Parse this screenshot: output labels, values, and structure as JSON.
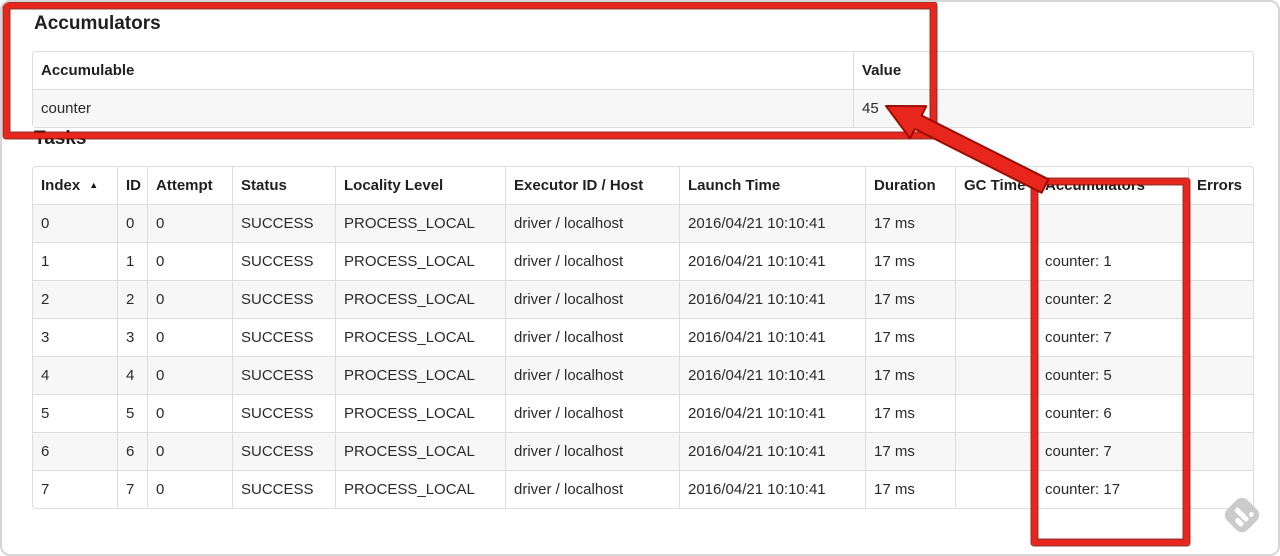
{
  "accumulators_section": {
    "title": "Accumulators",
    "table": {
      "headers": [
        "Accumulable",
        "Value"
      ],
      "rows": [
        {
          "accumulable": "counter",
          "value": "45"
        }
      ]
    }
  },
  "tasks_section": {
    "title": "Tasks",
    "table": {
      "headers": [
        "Index",
        "ID",
        "Attempt",
        "Status",
        "Locality Level",
        "Executor ID / Host",
        "Launch Time",
        "Duration",
        "GC Time",
        "Accumulators",
        "Errors"
      ],
      "sort": {
        "column": "Index",
        "direction": "asc",
        "icon": "▲"
      },
      "rows": [
        {
          "index": "0",
          "id": "0",
          "attempt": "0",
          "status": "SUCCESS",
          "locality_level": "PROCESS_LOCAL",
          "executor_id_host": "driver / localhost",
          "launch_time": "2016/04/21 10:10:41",
          "duration": "17 ms",
          "gc_time": "",
          "accumulators": "",
          "errors": ""
        },
        {
          "index": "1",
          "id": "1",
          "attempt": "0",
          "status": "SUCCESS",
          "locality_level": "PROCESS_LOCAL",
          "executor_id_host": "driver / localhost",
          "launch_time": "2016/04/21 10:10:41",
          "duration": "17 ms",
          "gc_time": "",
          "accumulators": "counter: 1",
          "errors": ""
        },
        {
          "index": "2",
          "id": "2",
          "attempt": "0",
          "status": "SUCCESS",
          "locality_level": "PROCESS_LOCAL",
          "executor_id_host": "driver / localhost",
          "launch_time": "2016/04/21 10:10:41",
          "duration": "17 ms",
          "gc_time": "",
          "accumulators": "counter: 2",
          "errors": ""
        },
        {
          "index": "3",
          "id": "3",
          "attempt": "0",
          "status": "SUCCESS",
          "locality_level": "PROCESS_LOCAL",
          "executor_id_host": "driver / localhost",
          "launch_time": "2016/04/21 10:10:41",
          "duration": "17 ms",
          "gc_time": "",
          "accumulators": "counter: 7",
          "errors": ""
        },
        {
          "index": "4",
          "id": "4",
          "attempt": "0",
          "status": "SUCCESS",
          "locality_level": "PROCESS_LOCAL",
          "executor_id_host": "driver / localhost",
          "launch_time": "2016/04/21 10:10:41",
          "duration": "17 ms",
          "gc_time": "",
          "accumulators": "counter: 5",
          "errors": ""
        },
        {
          "index": "5",
          "id": "5",
          "attempt": "0",
          "status": "SUCCESS",
          "locality_level": "PROCESS_LOCAL",
          "executor_id_host": "driver / localhost",
          "launch_time": "2016/04/21 10:10:41",
          "duration": "17 ms",
          "gc_time": "",
          "accumulators": "counter: 6",
          "errors": ""
        },
        {
          "index": "6",
          "id": "6",
          "attempt": "0",
          "status": "SUCCESS",
          "locality_level": "PROCESS_LOCAL",
          "executor_id_host": "driver / localhost",
          "launch_time": "2016/04/21 10:10:41",
          "duration": "17 ms",
          "gc_time": "",
          "accumulators": "counter: 7",
          "errors": ""
        },
        {
          "index": "7",
          "id": "7",
          "attempt": "0",
          "status": "SUCCESS",
          "locality_level": "PROCESS_LOCAL",
          "executor_id_host": "driver / localhost",
          "launch_time": "2016/04/21 10:10:41",
          "duration": "17 ms",
          "gc_time": "",
          "accumulators": "counter: 17",
          "errors": ""
        }
      ]
    }
  },
  "annotations": {
    "highlight_color": "#e8261d",
    "outline_color": "#9c0c02",
    "highlighted_value": "45",
    "highlighted_column": "Accumulators"
  },
  "watermark": {
    "icon": "feedly-logo",
    "color": "#c9c9c9"
  }
}
